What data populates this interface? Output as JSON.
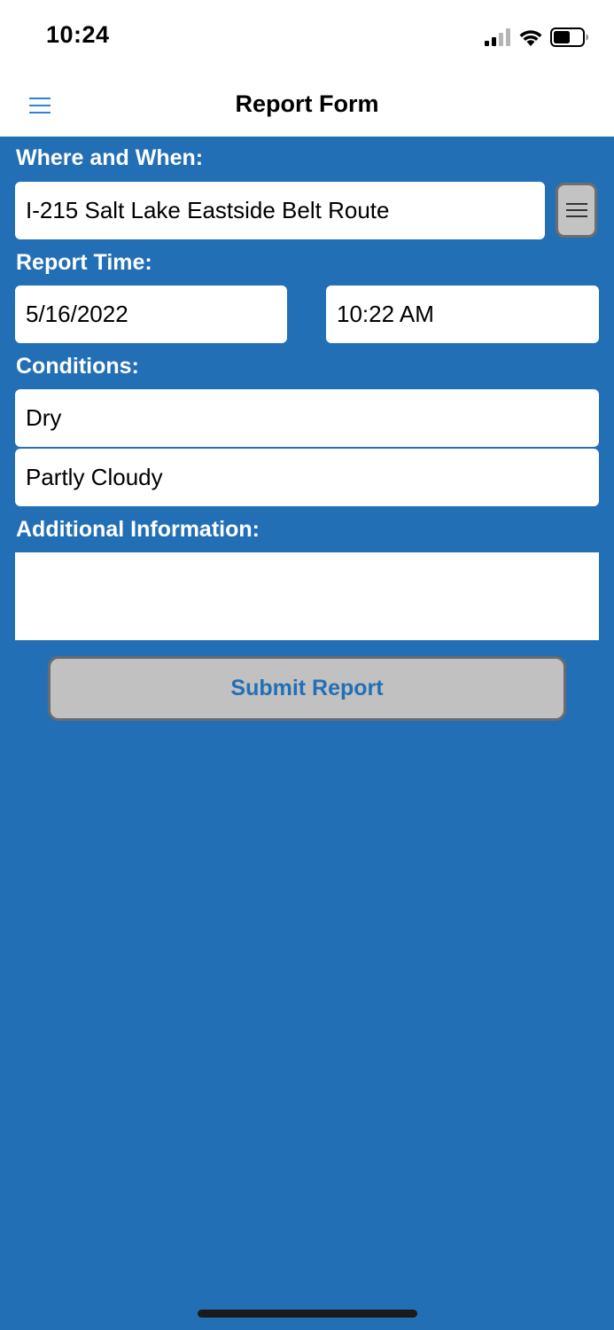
{
  "status_bar": {
    "time": "10:24"
  },
  "nav": {
    "title": "Report Form",
    "menu_icon": "hamburger-menu-icon"
  },
  "form": {
    "where_when_label": "Where and When:",
    "route_value": "I-215 Salt Lake Eastside Belt Route",
    "route_list_icon": "list-icon",
    "report_time_label": "Report Time:",
    "date_value": "5/16/2022",
    "time_value": "10:22 AM",
    "conditions_label": "Conditions:",
    "road_condition_value": "Dry",
    "sky_condition_value": "Partly Cloudy",
    "additional_info_label": "Additional Information:",
    "additional_info_value": "",
    "submit_label": "Submit Report"
  },
  "colors": {
    "background": "#236fb5",
    "accent": "#2f80d6",
    "button_gray": "#c1c1c1"
  }
}
